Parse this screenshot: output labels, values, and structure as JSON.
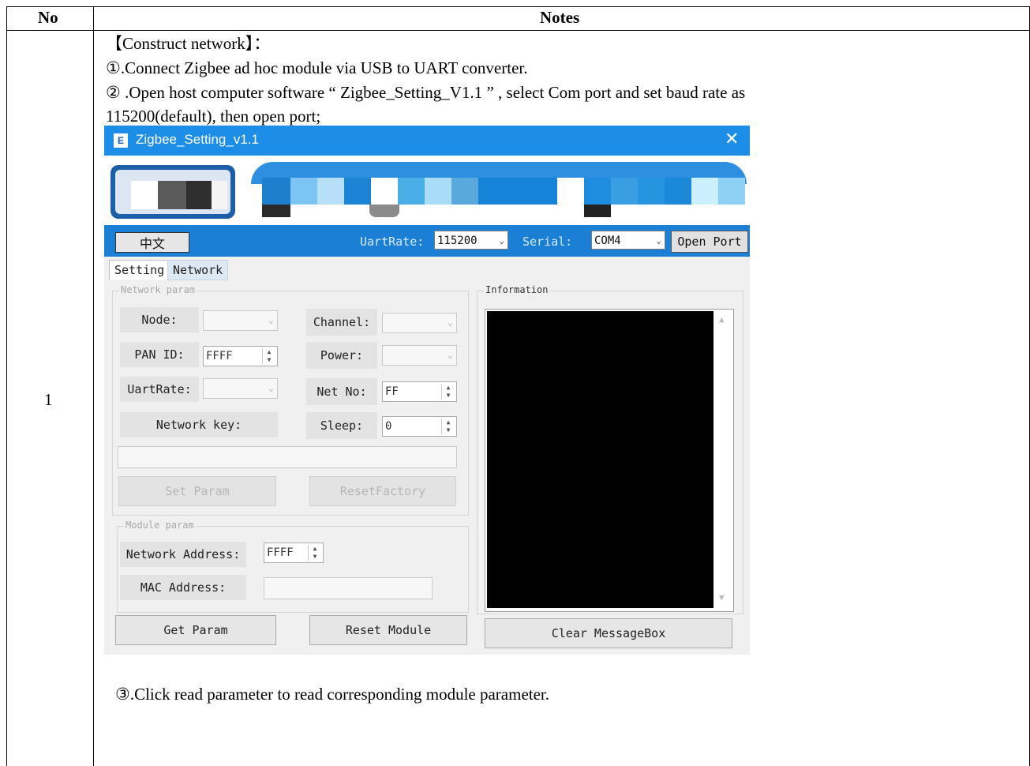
{
  "table": {
    "header_no": "No",
    "header_notes": "Notes",
    "row_number": "1"
  },
  "notes": {
    "heading": "【Construct network】：",
    "step1": "①.Connect Zigbee ad hoc module via USB to UART converter.",
    "step2_line1": "②  .Open host computer software “ Zigbee_Setting_V1.1 ” , select Com port and set baud rate as",
    "step2_line2": "115200(default), then open port;",
    "step3": "③.Click read parameter to read corresponding module parameter."
  },
  "app": {
    "icon_glyph": "E",
    "title": "Zigbee_Setting_v1.1",
    "close_glyph": "✕",
    "toolbar": {
      "lang_button": "中文",
      "uartrate_label": "UartRate:",
      "uartrate_value": "115200",
      "serial_label": "Serial:",
      "serial_value": "COM4",
      "open_port": "Open Port"
    },
    "tabs": {
      "setting": "Setting",
      "network": "Network"
    },
    "network_param": {
      "title": "Network param",
      "node_label": "Node:",
      "panid_label": "PAN ID:",
      "panid_value": "FFFF",
      "uartrate_label": "UartRate:",
      "network_key_label": "Network key:",
      "channel_label": "Channel:",
      "power_label": "Power:",
      "netno_label": "Net No:",
      "netno_value": "FF",
      "sleep_label": "Sleep:",
      "sleep_value": "0",
      "set_param": "Set Param",
      "reset_factory": "ResetFactory"
    },
    "module_param": {
      "title": "Module param",
      "network_address_label": "Network Address:",
      "network_address_value": "FFFF",
      "mac_address_label": "MAC Address:"
    },
    "buttons": {
      "get_param": "Get Param",
      "reset_module": "Reset Module",
      "clear_messagebox": "Clear MessageBox"
    },
    "information": {
      "title": "Information"
    }
  }
}
